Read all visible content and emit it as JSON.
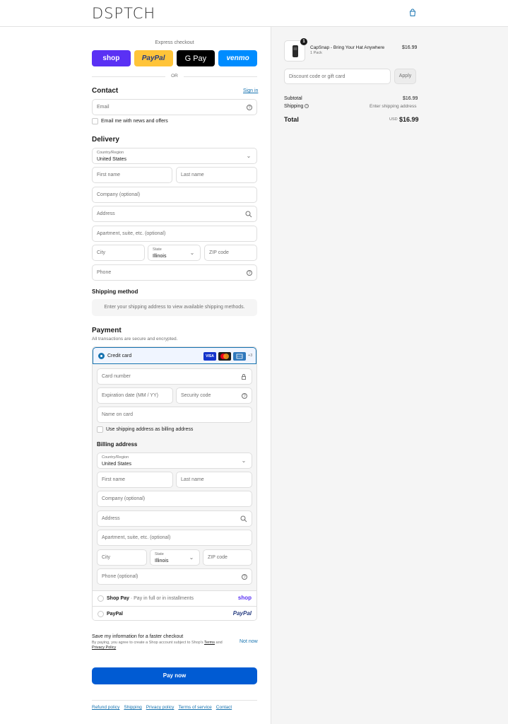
{
  "header": {
    "logo": "DSPTCH",
    "cart_icon": "shopping-bag-icon"
  },
  "express": {
    "label": "Express checkout",
    "buttons": [
      "shop",
      "PayPal",
      "G Pay",
      "venmo"
    ],
    "or": "OR"
  },
  "contact": {
    "title": "Contact",
    "sign_in": "Sign in",
    "email_placeholder": "Email",
    "newsletter": "Email me with news and offers"
  },
  "delivery": {
    "title": "Delivery",
    "country_label": "Country/Region",
    "country_value": "United States",
    "first_name": "First name",
    "last_name": "Last name",
    "company": "Company (optional)",
    "address": "Address",
    "apartment": "Apartment, suite, etc. (optional)",
    "city": "City",
    "state_label": "State",
    "state_value": "Illinois",
    "zip": "ZIP code",
    "phone": "Phone"
  },
  "shipping": {
    "title": "Shipping method",
    "info": "Enter your shipping address to view available shipping methods."
  },
  "payment": {
    "title": "Payment",
    "subtitle": "All transactions are secure and encrypted.",
    "credit_card": "Credit card",
    "card_logos": [
      "VISA",
      "MC",
      "AMEX"
    ],
    "more_cards": "+3",
    "card_number": "Card number",
    "expiration": "Expiration date (MM / YY)",
    "security": "Security code",
    "name_on_card": "Name on card",
    "use_shipping": "Use shipping address as billing address",
    "billing_title": "Billing address",
    "billing": {
      "country_label": "Country/Region",
      "country_value": "United States",
      "first_name": "First name",
      "last_name": "Last name",
      "company": "Company (optional)",
      "address": "Address",
      "apartment": "Apartment, suite, etc. (optional)",
      "city": "City",
      "state_label": "State",
      "state_value": "Illinois",
      "zip": "ZIP code",
      "phone": "Phone (optional)"
    },
    "shop_pay": "Shop Pay",
    "shop_pay_sub": " · Pay in full or in installments",
    "shop_brand": "shop",
    "paypal": "PayPal",
    "paypal_brand": "PayPal"
  },
  "save": {
    "title": "Save my information for a faster checkout",
    "sub_prefix": "By paying, you agree to create a Shop account subject to Shop's ",
    "terms": "Terms",
    "and": " and ",
    "privacy": "Privacy Policy",
    "not_now": "Not now"
  },
  "pay_now": "Pay now",
  "footer": [
    "Refund policy",
    "Shipping",
    "Privacy policy",
    "Terms of service",
    "Contact"
  ],
  "summary": {
    "qty": "1",
    "product_name": "CapSnap - Bring Your Hat Anywhere",
    "variant": "1 Pack",
    "price": "$16.99",
    "discount_placeholder": "Discount code or gift card",
    "apply": "Apply",
    "subtotal_label": "Subtotal",
    "subtotal_value": "$16.99",
    "shipping_label": "Shipping",
    "shipping_value": "Enter shipping address",
    "total_label": "Total",
    "currency": "USD",
    "total_value": "$16.99"
  },
  "colors": {
    "accent": "#1773b0",
    "pay_button": "#005bd3",
    "shop": "#5a31f4",
    "paypal": "#ffc439",
    "venmo": "#008cff"
  }
}
